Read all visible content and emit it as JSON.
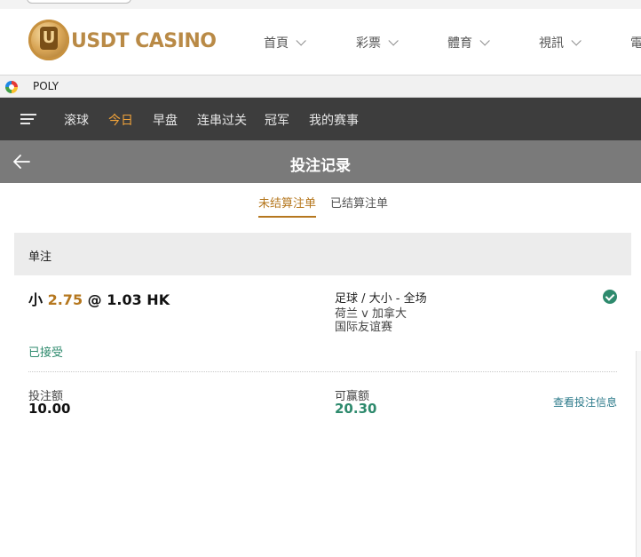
{
  "casino": {
    "brand": "USDT CASINO",
    "nav": [
      {
        "label": "首頁"
      },
      {
        "label": "彩票"
      },
      {
        "label": "體育"
      },
      {
        "label": "視訊"
      },
      {
        "label": "電"
      }
    ]
  },
  "frame": {
    "title": "POLY"
  },
  "sports_nav": {
    "tabs": [
      {
        "label": "滚球",
        "active": false
      },
      {
        "label": "今日",
        "active": true
      },
      {
        "label": "早盘",
        "active": false
      },
      {
        "label": "连串过关",
        "active": false
      },
      {
        "label": "冠军",
        "active": false
      },
      {
        "label": "我的赛事",
        "active": false
      }
    ]
  },
  "page": {
    "title": "投注记录"
  },
  "subtabs": [
    {
      "label": "未结算注单",
      "active": true
    },
    {
      "label": "已结算注单",
      "active": false
    }
  ],
  "bet": {
    "type_label": "单注",
    "selection": "小",
    "line": "2.75",
    "at": "@",
    "odds": "1.03",
    "odds_format": "HK",
    "market": "足球 / 大小 - 全场",
    "match": "荷兰 v 加拿大",
    "league": "国际友谊赛",
    "status": "已接受",
    "stake_label": "投注额",
    "stake": "10.00",
    "win_label": "可赢额",
    "win": "20.30",
    "details_link": "查看投注信息"
  },
  "colors": {
    "accent_gold": "#b5771e",
    "accept_green": "#2e8a6d",
    "nav_dark": "#3d3d3d",
    "header_gray": "#7a7a7a"
  }
}
